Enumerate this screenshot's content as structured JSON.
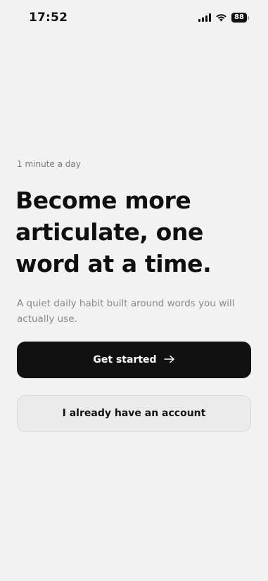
{
  "status_bar": {
    "time": "17:52",
    "battery_level": "88",
    "icons": [
      "signal-icon",
      "wifi-icon",
      "battery-icon"
    ]
  },
  "onboarding": {
    "kicker": "1 minute a day",
    "headline": "Become more articulate, one word at a time.",
    "subtext": "A quiet daily habit built around words you will actually use.",
    "primary_button": {
      "label": "Get started",
      "icon": "arrow-right-icon"
    },
    "secondary_button": {
      "label": "I already have an account"
    }
  },
  "colors": {
    "background": "#f2f2f2",
    "primary_button": "#111111",
    "primary_text": "#ffffff",
    "secondary_button": "#ebebeb",
    "muted_text": "#8a8a8a"
  }
}
